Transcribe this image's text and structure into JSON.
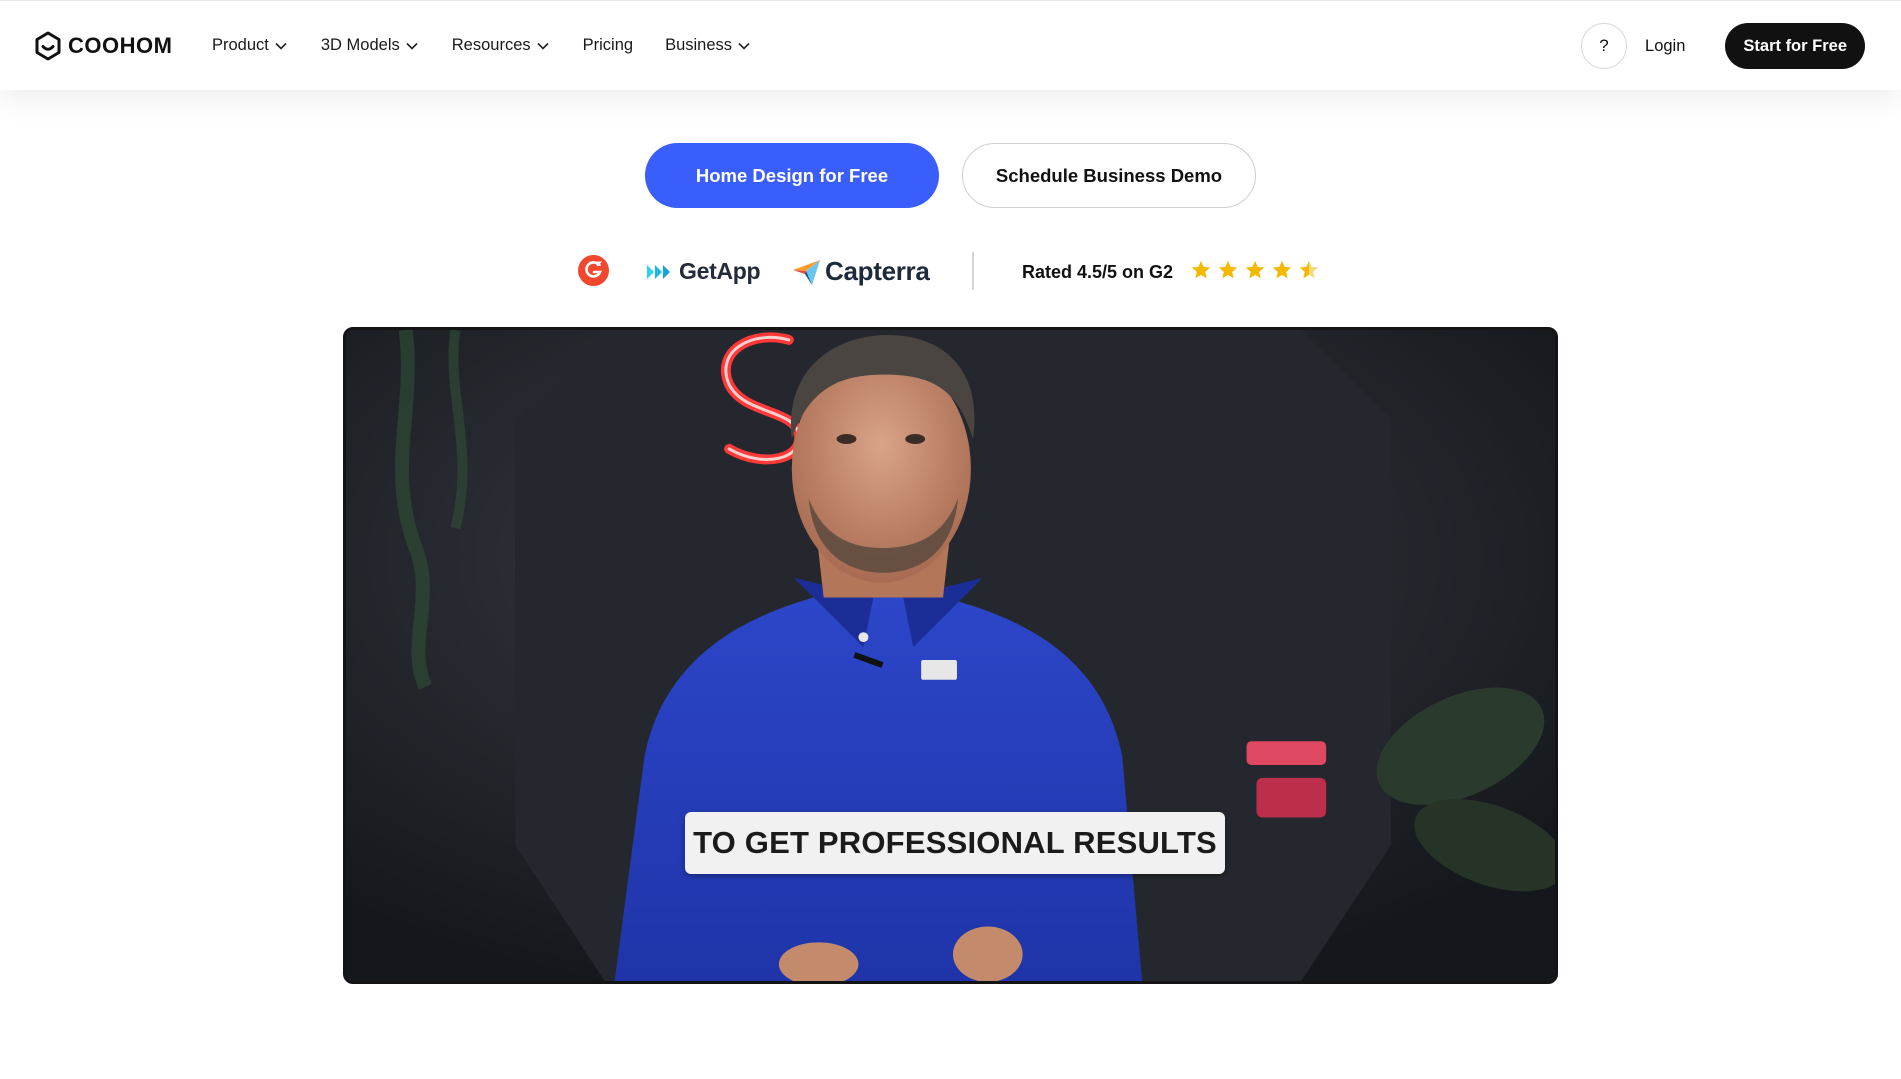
{
  "nav": {
    "logo_text": "COOHOM",
    "logo_icon": "coohom-hexagon-logo",
    "menu": [
      {
        "label": "Product",
        "has_dropdown": true
      },
      {
        "label": "3D Models",
        "has_dropdown": true
      },
      {
        "label": "Resources",
        "has_dropdown": true
      },
      {
        "label": "Pricing",
        "has_dropdown": false
      },
      {
        "label": "Business",
        "has_dropdown": true
      }
    ],
    "help_label": "?",
    "login_label": "Login",
    "start_label": "Start for Free"
  },
  "cta": {
    "primary_label": "Home Design for Free",
    "secondary_label": "Schedule Business Demo"
  },
  "ratings": {
    "g2_icon": "g2-logo",
    "getapp_label": "GetApp",
    "capterra_label": "Capterra",
    "rated_text": "Rated 4.5/5 on G2",
    "stars": 4.5,
    "star_color": "#f5b800"
  },
  "video": {
    "caption": "TO GET PROFESSIONAL RESULTS"
  },
  "colors": {
    "accent": "#3a5efb",
    "dark": "#111111"
  }
}
